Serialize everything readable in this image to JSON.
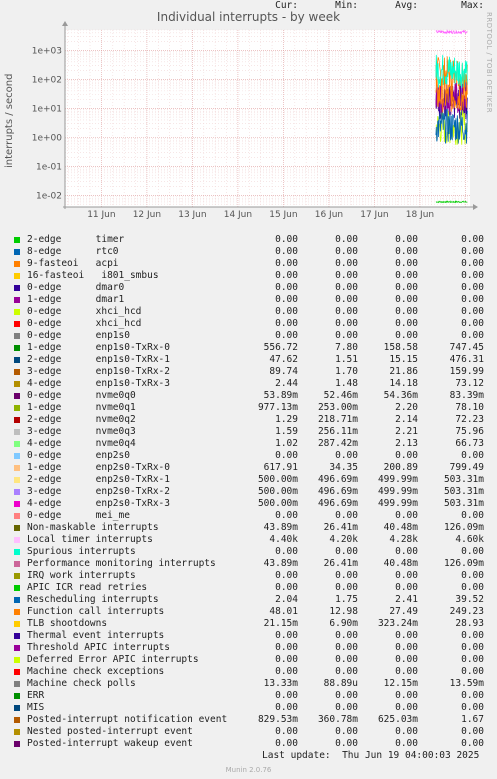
{
  "title": "Individual interrupts - by week",
  "ylabel": "interrupts / second",
  "side_label": "RRDTOOL / TOBI OETIKER",
  "chart_data": {
    "type": "line",
    "title": "Individual interrupts - by week",
    "ylabel": "interrupts / second",
    "yscale": "log",
    "yticks": [
      "1e-02",
      "1e-01",
      "1e+00",
      "1e+01",
      "1e+02",
      "1e+03"
    ],
    "ytick_values": [
      0.01,
      0.1,
      1,
      10,
      100,
      1000
    ],
    "ylim": [
      0.004,
      5000
    ],
    "xticks": [
      "11 Jun",
      "12 Jun",
      "13 Jun",
      "14 Jun",
      "15 Jun",
      "16 Jun",
      "17 Jun",
      "18 Jun"
    ],
    "xlim_days": [
      10.2,
      19.1
    ],
    "data_start_day": 18.35,
    "grid": true,
    "series": [
      {
        "name": "2-edge timer",
        "values_avg": 0.0,
        "color": "#00cc00"
      },
      {
        "name": "enp1s0-TxRx-0",
        "values_avg": 158.58,
        "color": "#ff8000"
      },
      {
        "name": "enp1s0-TxRx-1",
        "values_avg": 15.15,
        "color": "#330099"
      },
      {
        "name": "enp1s0-TxRx-2",
        "values_avg": 21.86,
        "color": "#990099"
      },
      {
        "name": "nvme0q1",
        "values_avg": 2.2,
        "color": "#ccff00"
      },
      {
        "name": "enp2s0-TxRx-0",
        "values_avg": 200.89,
        "color": "#00ffcc"
      },
      {
        "name": "Local timer interrupts",
        "values_avg": 4280,
        "color": "#ff66ff"
      },
      {
        "name": "Function call interrupts",
        "values_avg": 27.49,
        "color": "#ff8000"
      },
      {
        "name": "Rescheduling interrupts",
        "values_avg": 2.41,
        "color": "#0066b3"
      }
    ]
  },
  "legend": {
    "headers": [
      "Cur:",
      "Min:",
      "Avg:",
      "Max:"
    ],
    "rows": [
      {
        "label": "2-edge      timer",
        "color": "#00cc00",
        "cur": "0.00",
        "min": "0.00",
        "avg": "0.00",
        "max": "0.00"
      },
      {
        "label": "8-edge      rtc0",
        "color": "#0066b3",
        "cur": "0.00",
        "min": "0.00",
        "avg": "0.00",
        "max": "0.00"
      },
      {
        "label": "9-fasteoi   acpi",
        "color": "#ff8000",
        "cur": "0.00",
        "min": "0.00",
        "avg": "0.00",
        "max": "0.00"
      },
      {
        "label": "16-fasteoi   i801_smbus",
        "color": "#ffcc00",
        "cur": "0.00",
        "min": "0.00",
        "avg": "0.00",
        "max": "0.00"
      },
      {
        "label": "0-edge      dmar0",
        "color": "#330099",
        "cur": "0.00",
        "min": "0.00",
        "avg": "0.00",
        "max": "0.00"
      },
      {
        "label": "1-edge      dmar1",
        "color": "#990099",
        "cur": "0.00",
        "min": "0.00",
        "avg": "0.00",
        "max": "0.00"
      },
      {
        "label": "0-edge      xhci_hcd",
        "color": "#ccff00",
        "cur": "0.00",
        "min": "0.00",
        "avg": "0.00",
        "max": "0.00"
      },
      {
        "label": "0-edge      xhci_hcd",
        "color": "#ff0000",
        "cur": "0.00",
        "min": "0.00",
        "avg": "0.00",
        "max": "0.00"
      },
      {
        "label": "0-edge      enp1s0",
        "color": "#808080",
        "cur": "0.00",
        "min": "0.00",
        "avg": "0.00",
        "max": "0.00"
      },
      {
        "label": "1-edge      enp1s0-TxRx-0",
        "color": "#008f00",
        "cur": "556.72",
        "min": "7.80",
        "avg": "158.58",
        "max": "747.45"
      },
      {
        "label": "2-edge      enp1s0-TxRx-1",
        "color": "#00487d",
        "cur": "47.62",
        "min": "1.51",
        "avg": "15.15",
        "max": "476.31"
      },
      {
        "label": "3-edge      enp1s0-TxRx-2",
        "color": "#b35a00",
        "cur": "89.74",
        "min": "1.70",
        "avg": "21.86",
        "max": "159.99"
      },
      {
        "label": "4-edge      enp1s0-TxRx-3",
        "color": "#b38f00",
        "cur": "2.44",
        "min": "1.48",
        "avg": "14.18",
        "max": "73.12"
      },
      {
        "label": "0-edge      nvme0q0",
        "color": "#6b006b",
        "cur": "53.89m",
        "min": "52.46m",
        "avg": "54.36m",
        "max": "83.39m"
      },
      {
        "label": "1-edge      nvme0q1",
        "color": "#8fb300",
        "cur": "977.13m",
        "min": "253.00m",
        "avg": "2.20",
        "max": "78.10"
      },
      {
        "label": "2-edge      nvme0q2",
        "color": "#b30000",
        "cur": "1.29",
        "min": "218.71m",
        "avg": "2.14",
        "max": "72.23"
      },
      {
        "label": "3-edge      nvme0q3",
        "color": "#bebebe",
        "cur": "1.59",
        "min": "256.11m",
        "avg": "2.21",
        "max": "75.96"
      },
      {
        "label": "4-edge      nvme0q4",
        "color": "#80ff80",
        "cur": "1.02",
        "min": "287.42m",
        "avg": "2.13",
        "max": "66.73"
      },
      {
        "label": "0-edge      enp2s0",
        "color": "#80c9ff",
        "cur": "0.00",
        "min": "0.00",
        "avg": "0.00",
        "max": "0.00"
      },
      {
        "label": "1-edge      enp2s0-TxRx-0",
        "color": "#ffc080",
        "cur": "617.91",
        "min": "34.35",
        "avg": "200.89",
        "max": "799.49"
      },
      {
        "label": "2-edge      enp2s0-TxRx-1",
        "color": "#ffe680",
        "cur": "500.00m",
        "min": "496.69m",
        "avg": "499.99m",
        "max": "503.31m"
      },
      {
        "label": "3-edge      enp2s0-TxRx-2",
        "color": "#aa80ff",
        "cur": "500.00m",
        "min": "496.69m",
        "avg": "499.99m",
        "max": "503.31m"
      },
      {
        "label": "4-edge      enp2s0-TxRx-3",
        "color": "#ee00cc",
        "cur": "500.00m",
        "min": "496.69m",
        "avg": "499.99m",
        "max": "503.31m"
      },
      {
        "label": "0-edge      mei_me",
        "color": "#ff8080",
        "cur": "0.00",
        "min": "0.00",
        "avg": "0.00",
        "max": "0.00"
      },
      {
        "label": "Non-maskable interrupts",
        "color": "#666600",
        "cur": "43.89m",
        "min": "26.41m",
        "avg": "40.48m",
        "max": "126.09m"
      },
      {
        "label": "Local timer interrupts",
        "color": "#ffbfff",
        "cur": "4.40k",
        "min": "4.20k",
        "avg": "4.28k",
        "max": "4.60k"
      },
      {
        "label": "Spurious interrupts",
        "color": "#00ffcc",
        "cur": "0.00",
        "min": "0.00",
        "avg": "0.00",
        "max": "0.00"
      },
      {
        "label": "Performance monitoring interrupts",
        "color": "#cc6699",
        "cur": "43.89m",
        "min": "26.41m",
        "avg": "40.48m",
        "max": "126.09m"
      },
      {
        "label": "IRQ work interrupts",
        "color": "#999900",
        "cur": "0.00",
        "min": "0.00",
        "avg": "0.00",
        "max": "0.00"
      },
      {
        "label": "APIC ICR read retries",
        "color": "#00cc00",
        "cur": "0.00",
        "min": "0.00",
        "avg": "0.00",
        "max": "0.00"
      },
      {
        "label": "Rescheduling interrupts",
        "color": "#0066b3",
        "cur": "2.04",
        "min": "1.75",
        "avg": "2.41",
        "max": "39.52"
      },
      {
        "label": "Function call interrupts",
        "color": "#ff8000",
        "cur": "48.01",
        "min": "12.98",
        "avg": "27.49",
        "max": "249.23"
      },
      {
        "label": "TLB shootdowns",
        "color": "#ffcc00",
        "cur": "21.15m",
        "min": "6.90m",
        "avg": "323.24m",
        "max": "28.93"
      },
      {
        "label": "Thermal event interrupts",
        "color": "#330099",
        "cur": "0.00",
        "min": "0.00",
        "avg": "0.00",
        "max": "0.00"
      },
      {
        "label": "Threshold APIC interrupts",
        "color": "#990099",
        "cur": "0.00",
        "min": "0.00",
        "avg": "0.00",
        "max": "0.00"
      },
      {
        "label": "Deferred Error APIC interrupts",
        "color": "#ccff00",
        "cur": "0.00",
        "min": "0.00",
        "avg": "0.00",
        "max": "0.00"
      },
      {
        "label": "Machine check exceptions",
        "color": "#ff0000",
        "cur": "0.00",
        "min": "0.00",
        "avg": "0.00",
        "max": "0.00"
      },
      {
        "label": "Machine check polls",
        "color": "#808080",
        "cur": "13.33m",
        "min": "88.89u",
        "avg": "12.15m",
        "max": "13.59m"
      },
      {
        "label": "ERR",
        "color": "#008f00",
        "cur": "0.00",
        "min": "0.00",
        "avg": "0.00",
        "max": "0.00"
      },
      {
        "label": "MIS",
        "color": "#00487d",
        "cur": "0.00",
        "min": "0.00",
        "avg": "0.00",
        "max": "0.00"
      },
      {
        "label": "Posted-interrupt notification event",
        "color": "#b35a00",
        "cur": "829.53m",
        "min": "360.78m",
        "avg": "625.03m",
        "max": "1.67"
      },
      {
        "label": "Nested posted-interrupt event",
        "color": "#b38f00",
        "cur": "0.00",
        "min": "0.00",
        "avg": "0.00",
        "max": "0.00"
      },
      {
        "label": "Posted-interrupt wakeup event",
        "color": "#6b006b",
        "cur": "0.00",
        "min": "0.00",
        "avg": "0.00",
        "max": "0.00"
      }
    ]
  },
  "last_update": "Last update:  Thu Jun 19 04:00:03 2025",
  "footer": "Munin 2.0.76"
}
